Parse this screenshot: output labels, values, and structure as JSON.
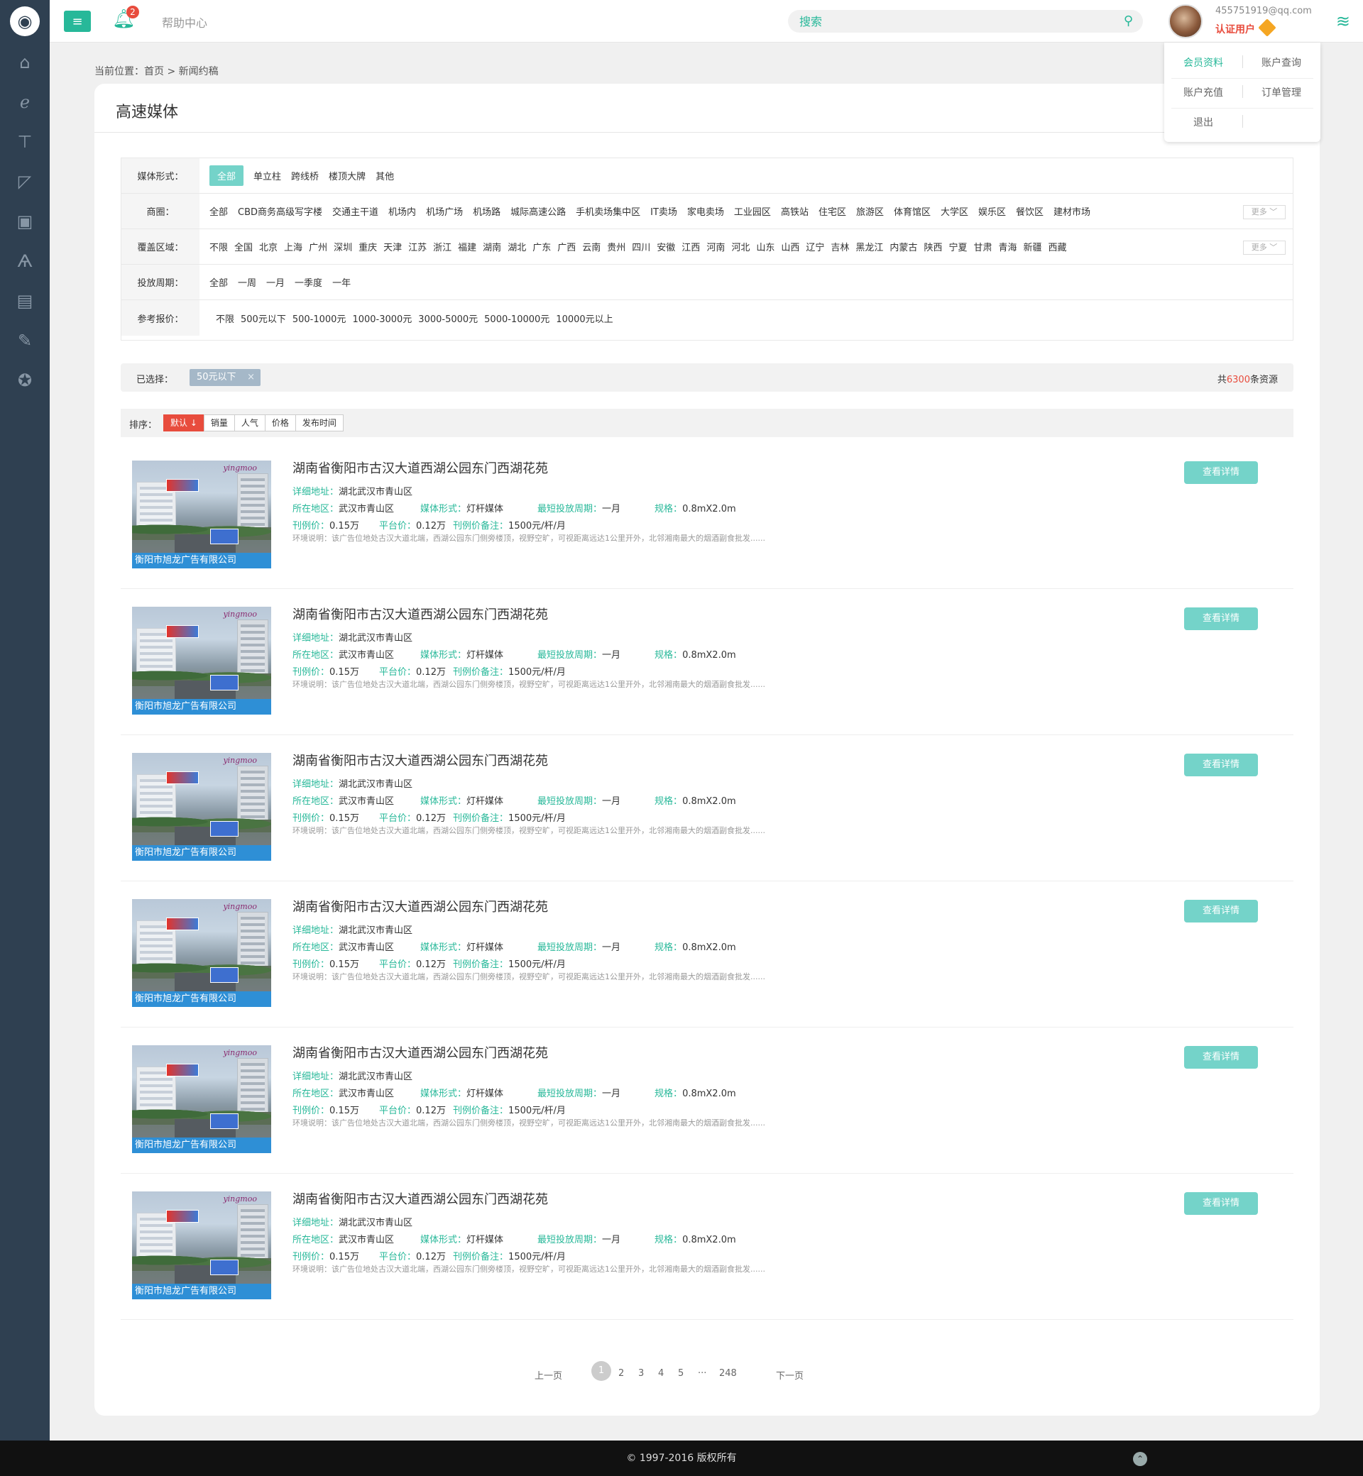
{
  "header": {
    "help": "帮助中心",
    "notifications": "2",
    "search_placeholder": "搜索",
    "user_email": "455751919@qq.com",
    "user_cert": "认证用户"
  },
  "user_menu": {
    "profile": "会员资料",
    "account_query": "账户查询",
    "recharge": "账户充值",
    "orders": "订单管理",
    "logout": "退出"
  },
  "breadcrumb": "当前位置：首页 > 新闻约稿",
  "page_title": "高速媒体",
  "filters": {
    "media_form": {
      "label": "媒体形式：",
      "options": [
        "全部",
        "单立柱",
        "跨线桥",
        "楼顶大牌",
        "其他"
      ],
      "active": "全部"
    },
    "business_area": {
      "label": "商圈：",
      "options": [
        "全部",
        "CBD商务高级写字楼",
        "交通主干道",
        "机场内",
        "机场广场",
        "机场路",
        "城际高速公路",
        "手机卖场集中区",
        "IT卖场",
        "家电卖场",
        "工业园区",
        "高铁站",
        "住宅区",
        "旅游区",
        "体育馆区",
        "大学区",
        "娱乐区",
        "餐饮区",
        "建材市场"
      ],
      "more": "更多 ﹀"
    },
    "coverage": {
      "label": "覆盖区域：",
      "options": [
        "不限",
        "全国",
        "北京",
        "上海",
        "广州",
        "深圳",
        "重庆",
        "天津",
        "江苏",
        "浙江",
        "福建",
        "湖南",
        "湖北",
        "广东",
        "广西",
        "云南",
        "贵州",
        "四川",
        "安徽",
        "江西",
        "河南",
        "河北",
        "山东",
        "山西",
        "辽宁",
        "吉林",
        "黑龙江",
        "内蒙古",
        "陕西",
        "宁夏",
        "甘肃",
        "青海",
        "新疆",
        "西藏"
      ],
      "more": "更多 ﹀"
    },
    "period": {
      "label": "投放周期：",
      "options": [
        "全部",
        "一周",
        "一月",
        "一季度",
        "一年"
      ]
    },
    "price": {
      "label": "参考报价：",
      "options": [
        "不限",
        "500元以下",
        "500-1000元",
        "1000-3000元",
        "3000-5000元",
        "5000-10000元",
        "10000元以上"
      ]
    }
  },
  "selected": {
    "label": "已选择：",
    "chip": "50元以下",
    "total_prefix": "共",
    "total_num": "6300",
    "total_suffix": "条资源"
  },
  "sort": {
    "label": "排序：",
    "options": [
      "默认 ↓",
      "销量",
      "人气",
      "价格",
      "发布时间"
    ]
  },
  "listing_template": {
    "title": "湖南省衡阳市古汉大道西湖公园东门西湖花苑",
    "addr_k": "详细地址：",
    "addr_v": "湖北武汉市青山区",
    "area_k": "所在地区：",
    "area_v": "武汉市青山区",
    "form_k": "媒体形式：",
    "form_v": "灯杆媒体",
    "period_k": "最短投放周期：",
    "period_v": "一月",
    "spec_k": "规格：",
    "spec_v": "0.8mX2.0m",
    "price_k": "刊例价：",
    "price_v": "0.15万",
    "platform_k": "平台价：",
    "platform_v": "0.12万",
    "note_k": "刊例价备注：",
    "note_v": "1500元/杆/月",
    "desc": "环境说明：该广告位地处古汉大道北端，西湖公园东门侧旁楼顶，视野空旷，可视距离远达1公里开外，北邻湘南最大的烟酒副食批发......",
    "caption": "衡阳市旭龙广告有限公司",
    "brand": "yingmoo",
    "button": "查看详情"
  },
  "listing_count": 6,
  "pagination": {
    "prev": "上一页",
    "pages": [
      "1",
      "2",
      "3",
      "4",
      "5",
      "···",
      "248"
    ],
    "next": "下一页",
    "current": "1"
  },
  "footer": "© 1997-2016 版权所有",
  "colors": {
    "accent": "#27b899",
    "sidebar": "#2f4051",
    "danger": "#e84c3d"
  }
}
